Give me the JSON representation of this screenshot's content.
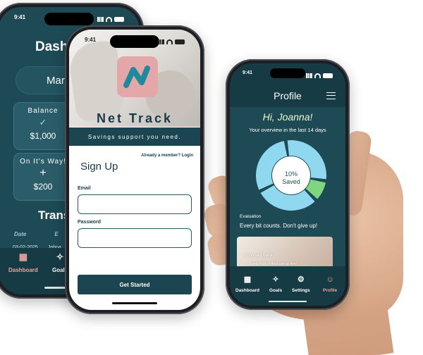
{
  "colors": {
    "teal_dark": "#173b45",
    "teal": "#1e4a55",
    "accent_pink": "#e3a7a9",
    "tab_active": "#e8a4a0",
    "donut_light": "#8fd8ef",
    "donut_green": "#7fd67e"
  },
  "dashboard": {
    "time": "9:41",
    "title": "Dash",
    "month": "March",
    "cards": [
      {
        "title": "Balance",
        "icon": "check-circle-icon",
        "glyph": "✓",
        "value": "$1,000"
      },
      {
        "title": "On It's Way!",
        "icon": "plus-icon",
        "glyph": "+",
        "value": "$200"
      }
    ],
    "section": "Trans",
    "columns": [
      "Date",
      "E"
    ],
    "rows": [
      {
        "date": "03-02-2025",
        "desc": "Johna"
      }
    ],
    "tabs": [
      {
        "label": "Dashboard",
        "icon": "grid-icon",
        "glyph": "▦"
      },
      {
        "label": "Goals",
        "icon": "sparkle-icon",
        "glyph": "✧"
      }
    ]
  },
  "signup": {
    "time": "9:41",
    "brand": "Net Track",
    "tagline": "Savings support you need.",
    "member_prompt": "Already a member?",
    "login_link": "Login",
    "heading": "Sign Up",
    "email_label": "Email",
    "password_label": "Password",
    "button": "Get Started"
  },
  "profile": {
    "time": "9:41",
    "title": "Profile",
    "greeting": "Hi, Joanna!",
    "overview": "Your overview in the last 14 days",
    "chart_data": {
      "type": "pie",
      "donut": true,
      "center_value": "10%",
      "center_label": "Saved",
      "slices": [
        {
          "value": 10,
          "color": "#7fd67e"
        },
        {
          "value": 90,
          "color": "#8fd8ef"
        }
      ]
    },
    "evaluation_label": "Evaluation",
    "evaluation_text": "Every bit counts. Don't give up!",
    "connect_title": "Connect bank",
    "connect_sub": "Keep track of finances as they",
    "tabs": [
      {
        "label": "Dashboard",
        "icon": "grid-icon",
        "glyph": "▦"
      },
      {
        "label": "Goals",
        "icon": "sparkle-icon",
        "glyph": "✧"
      },
      {
        "label": "Settings",
        "icon": "gear-icon",
        "glyph": "⚙"
      },
      {
        "label": "Profile",
        "icon": "user-icon",
        "glyph": "☺"
      }
    ]
  }
}
